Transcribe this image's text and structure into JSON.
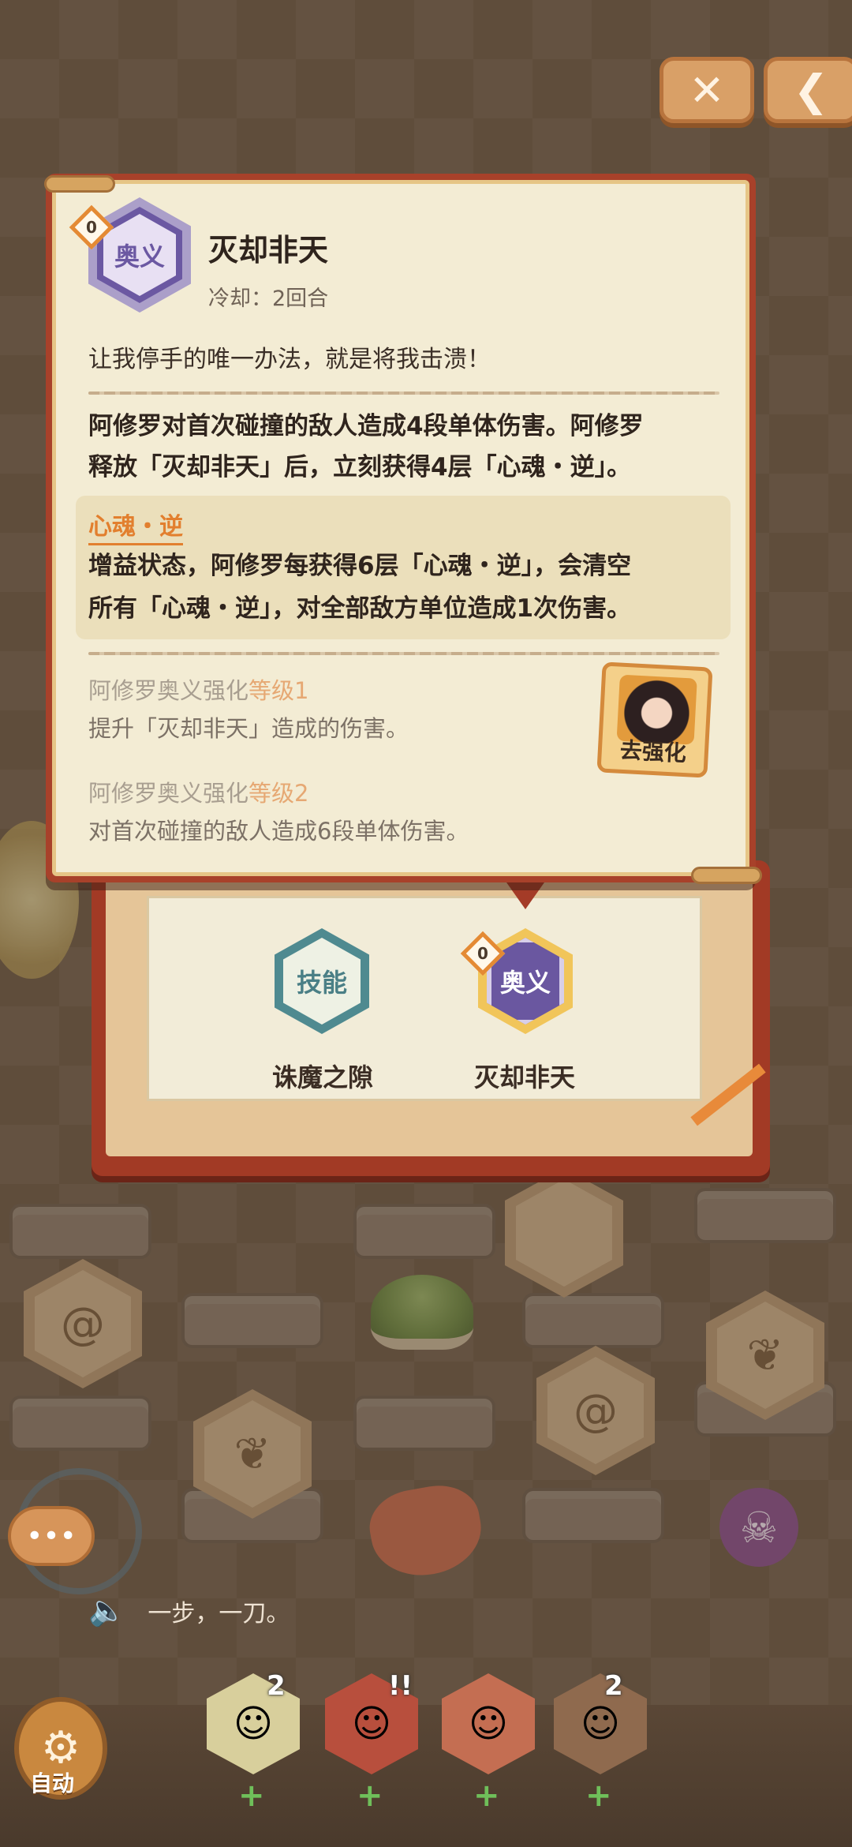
{
  "top_bar": {
    "close_label": "✕",
    "back_label": "❮"
  },
  "popup": {
    "ult_badge": "奥义",
    "level_marker": "0",
    "skill_name": "灭却非天",
    "cooldown": "冷却：2回合",
    "quote": "让我停手的唯一办法，就是将我击溃！",
    "effect_lines": [
      "阿修罗对首次碰撞的敌人造成4段单体伤害。阿修罗",
      "释放「灭却非天」后，立刻获得4层「心魂・逆」。"
    ],
    "buff": {
      "name": "心魂・逆",
      "desc_lines": [
        "增益状态，阿修罗每获得6层「心魂・逆」，会清空",
        "所有「心魂・逆」，对全部敌方单位造成1次伤害。"
      ]
    },
    "upgrades": [
      {
        "title_prefix": "阿修罗奥义强化",
        "level": "等级1",
        "desc": "提升「灭却非天」造成的伤害。"
      },
      {
        "title_prefix": "阿修罗奥义强化",
        "level": "等级2",
        "desc": "对首次碰撞的敌人造成6段单体伤害。"
      }
    ],
    "go_enhance_label": "去强化"
  },
  "skills": [
    {
      "badge": "技能",
      "name": "诛魔之隙"
    },
    {
      "badge": "奥义",
      "name": "灭却非天",
      "level_marker": "0"
    }
  ],
  "chat": {
    "button_label": "•••",
    "speech": "一步，一刀。"
  },
  "auto_button": {
    "label": "自动"
  },
  "team": [
    {
      "badge": "2"
    },
    {
      "badge": "!!"
    },
    {
      "badge": ""
    },
    {
      "badge": "2"
    }
  ],
  "colors": {
    "accent_orange": "#e27f2e",
    "ultimate_purple": "#6b58a2",
    "skill_teal": "#4f8a90",
    "frame_red": "#a8412a"
  }
}
